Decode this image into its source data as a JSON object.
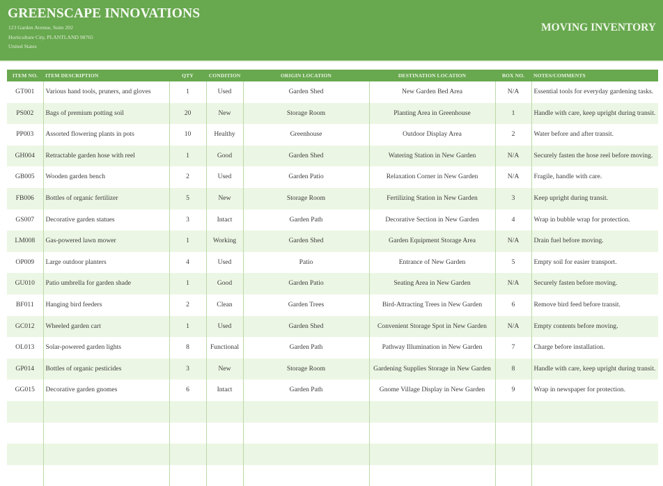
{
  "header": {
    "company_name": "GREENSCAPE INNOVATIONS",
    "address_line1": "123 Garden Avenue, Suite 202",
    "address_line2": "Horticulture City, PLANTLAND 98765",
    "address_line3": "United States",
    "document_title": "MOVING INVENTORY"
  },
  "colors": {
    "brand_green": "#68a84f",
    "row_stripe": "#ecf6e4",
    "divider": "#b9d9a8"
  },
  "table": {
    "columns": [
      "ITEM NO.",
      "ITEM DESCRIPTION",
      "QTY",
      "CONDITION",
      "ORIGIN LOCATION",
      "DESTINATION LOCATION",
      "BOX NO.",
      "NOTES/COMMENTS"
    ],
    "rows": [
      {
        "item_no": "GT001",
        "description": "Various hand tools, pruners, and gloves",
        "qty": "1",
        "condition": "Used",
        "origin": "Garden Shed",
        "destination": "New Garden Bed Area",
        "box_no": "N/A",
        "notes": "Essential tools for everyday gardening tasks."
      },
      {
        "item_no": "PS002",
        "description": "Bags of premium potting soil",
        "qty": "20",
        "condition": "New",
        "origin": "Storage Room",
        "destination": "Planting Area in Greenhouse",
        "box_no": "1",
        "notes": "Handle with care, keep upright during transit."
      },
      {
        "item_no": "PP003",
        "description": "Assorted flowering plants in pots",
        "qty": "10",
        "condition": "Healthy",
        "origin": "Greenhouse",
        "destination": "Outdoor Display Area",
        "box_no": "2",
        "notes": "Water before and after transit."
      },
      {
        "item_no": "GH004",
        "description": "Retractable garden hose with reel",
        "qty": "1",
        "condition": "Good",
        "origin": "Garden Shed",
        "destination": "Watering Station in New Garden",
        "box_no": "N/A",
        "notes": "Securely fasten the hose reel before moving."
      },
      {
        "item_no": "GB005",
        "description": "Wooden garden bench",
        "qty": "2",
        "condition": "Used",
        "origin": "Garden Patio",
        "destination": "Relaxation Corner in New Garden",
        "box_no": "N/A",
        "notes": "Fragile, handle with care."
      },
      {
        "item_no": "FB006",
        "description": "Bottles of organic fertilizer",
        "qty": "5",
        "condition": "New",
        "origin": "Storage Room",
        "destination": "Fertilizing Station in New Garden",
        "box_no": "3",
        "notes": "Keep upright during transit."
      },
      {
        "item_no": "GS007",
        "description": "Decorative garden statues",
        "qty": "3",
        "condition": "Intact",
        "origin": "Garden Path",
        "destination": "Decorative Section in New Garden",
        "box_no": "4",
        "notes": "Wrap in bubble wrap for protection."
      },
      {
        "item_no": "LM008",
        "description": "Gas-powered lawn mower",
        "qty": "1",
        "condition": "Working",
        "origin": "Garden Shed",
        "destination": "Garden Equipment Storage Area",
        "box_no": "N/A",
        "notes": "Drain fuel before moving."
      },
      {
        "item_no": "OP009",
        "description": "Large outdoor planters",
        "qty": "4",
        "condition": "Used",
        "origin": "Patio",
        "destination": "Entrance of New Garden",
        "box_no": "5",
        "notes": "Empty soil for easier transport."
      },
      {
        "item_no": "GU010",
        "description": "Patio umbrella for garden shade",
        "qty": "1",
        "condition": "Good",
        "origin": "Garden Patio",
        "destination": "Seating Area in New Garden",
        "box_no": "N/A",
        "notes": "Securely fasten before moving."
      },
      {
        "item_no": "BF011",
        "description": "Hanging bird feeders",
        "qty": "2",
        "condition": "Clean",
        "origin": "Garden Trees",
        "destination": "Bird-Attracting Trees in New Garden",
        "box_no": "6",
        "notes": "Remove bird feed before transit."
      },
      {
        "item_no": "GC012",
        "description": "Wheeled garden cart",
        "qty": "1",
        "condition": "Used",
        "origin": "Garden Shed",
        "destination": "Convenient Storage Spot in New Garden",
        "box_no": "N/A",
        "notes": "Empty contents before moving."
      },
      {
        "item_no": "OL013",
        "description": "Solar-powered garden lights",
        "qty": "8",
        "condition": "Functional",
        "origin": "Garden Path",
        "destination": "Pathway Illumination in New Garden",
        "box_no": "7",
        "notes": "Charge before installation."
      },
      {
        "item_no": "GP014",
        "description": "Bottles of organic pesticides",
        "qty": "3",
        "condition": "New",
        "origin": "Storage Room",
        "destination": "Gardening Supplies Storage in New Garden",
        "box_no": "8",
        "notes": "Handle with care, keep upright during transit."
      },
      {
        "item_no": "GG015",
        "description": "Decorative garden gnomes",
        "qty": "6",
        "condition": "Intact",
        "origin": "Garden Path",
        "destination": "Gnome Village Display in New Garden",
        "box_no": "9",
        "notes": "Wrap in newspaper for protection."
      }
    ],
    "empty_rows": 4
  }
}
